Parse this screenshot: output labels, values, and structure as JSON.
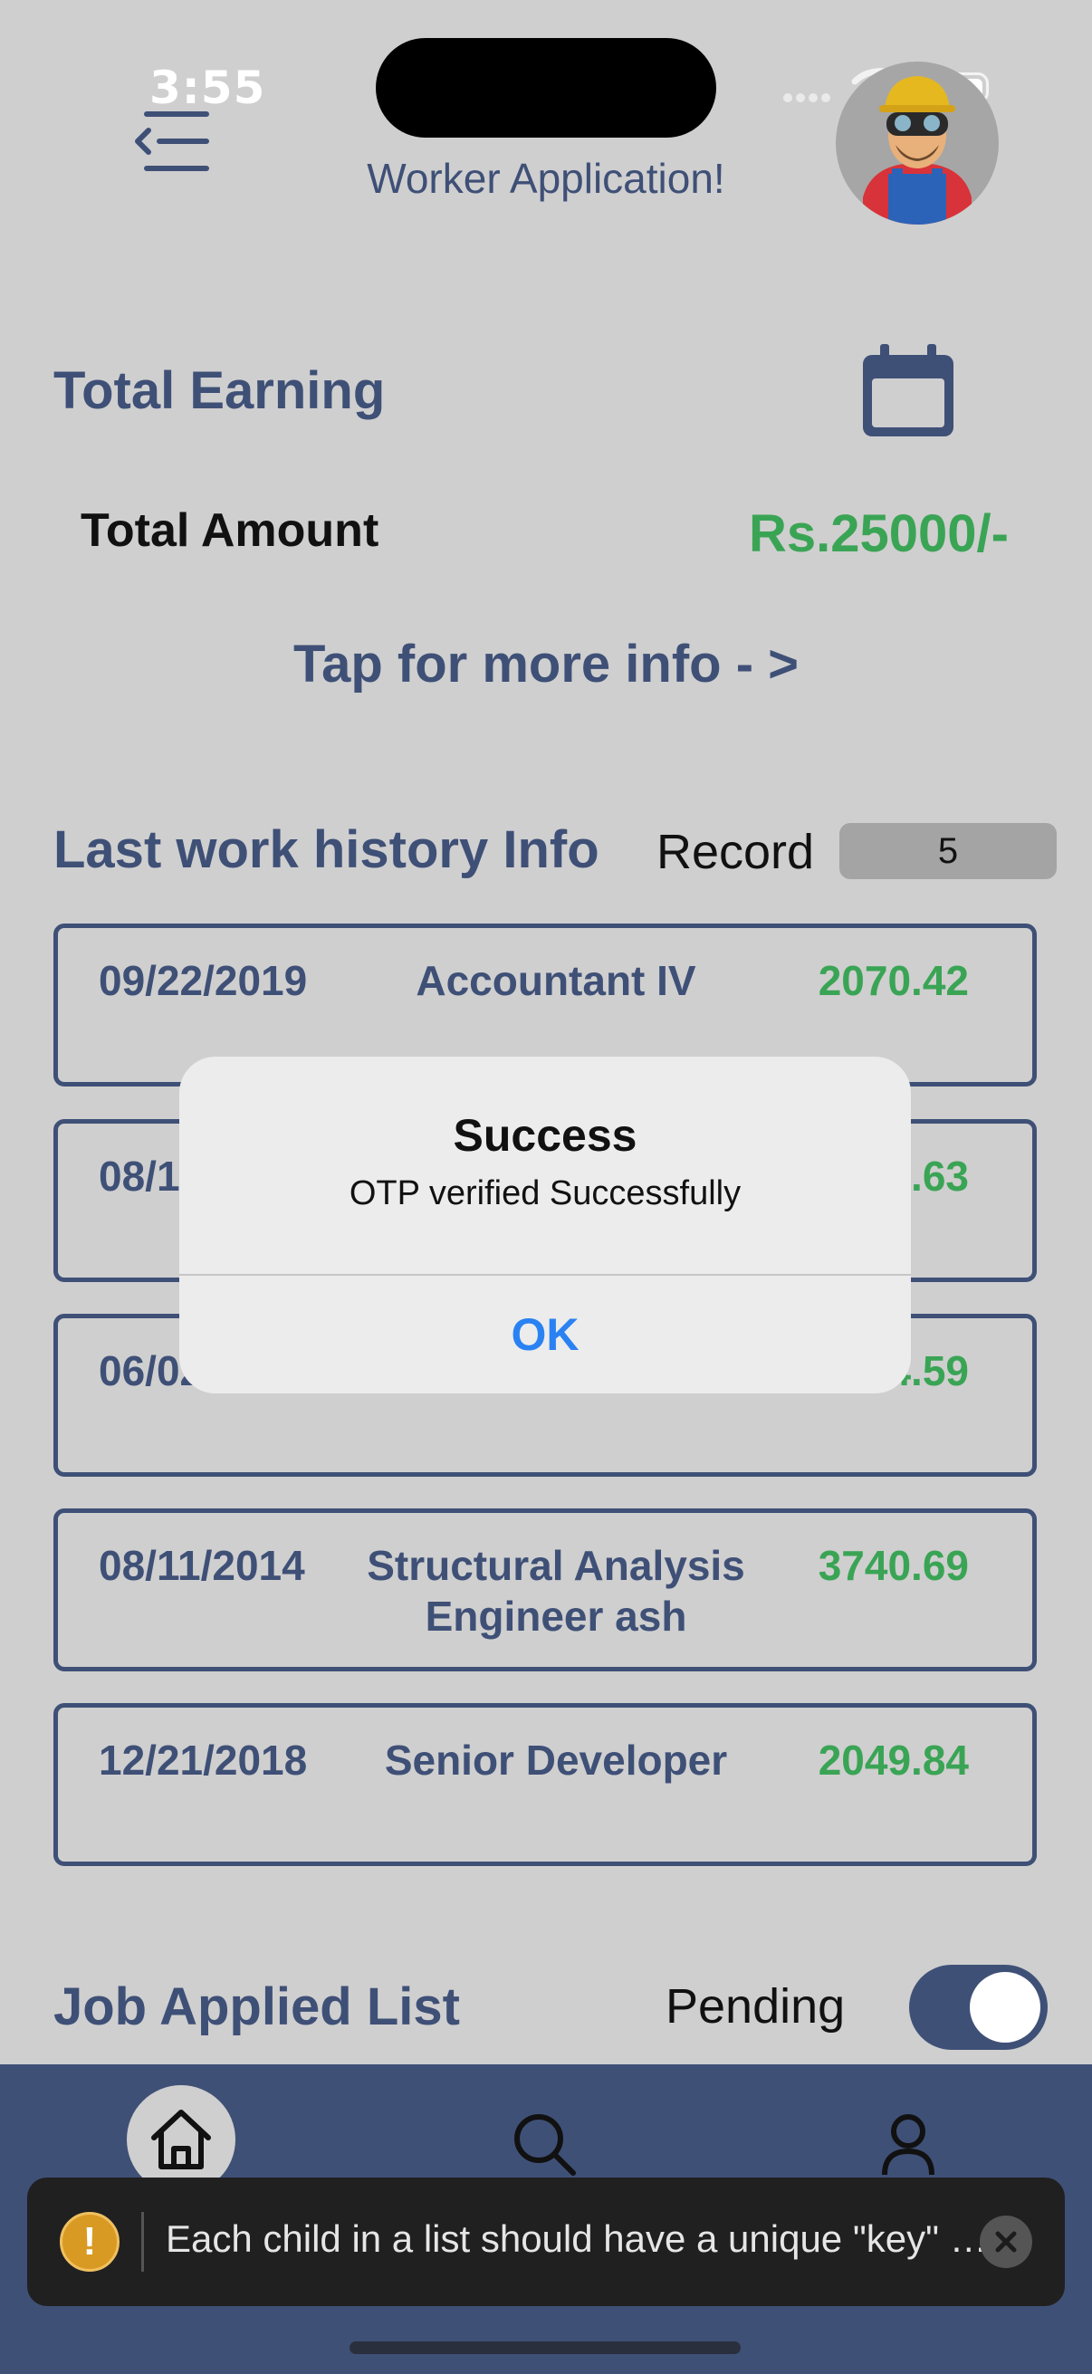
{
  "status": {
    "time": "3:55"
  },
  "header": {
    "title": "Worker Application!"
  },
  "earning": {
    "title": "Total Earning",
    "total_label": "Total Amount",
    "total_value": "Rs.25000/-",
    "tap_info": "Tap for more info - >"
  },
  "history": {
    "title": "Last work history Info",
    "record_label": "Record",
    "record_count": "5",
    "items": [
      {
        "date": "09/22/2019",
        "title": "Accountant IV",
        "amount": "2070.42"
      },
      {
        "date": "08/12/2012",
        "title": "",
        "amount": "4.63"
      },
      {
        "date": "06/02/2019",
        "title": "",
        "amount": "4.59"
      },
      {
        "date": "08/11/2014",
        "title": "Structural Analysis Engineer ash",
        "amount": "3740.69"
      },
      {
        "date": "12/21/2018",
        "title": "Senior Developer",
        "amount": "2049.84"
      }
    ]
  },
  "jobs": {
    "title": "Job Applied List",
    "pending_label": "Pending",
    "pending_on": true
  },
  "dialog": {
    "title": "Success",
    "message": "OTP verified Successfully",
    "ok": "OK"
  },
  "toast": {
    "message": "Each child in a list should have a unique \"key\" prop."
  },
  "colors": {
    "primary": "#3f5077",
    "money": "#3aa455",
    "link": "#2a82f2"
  }
}
